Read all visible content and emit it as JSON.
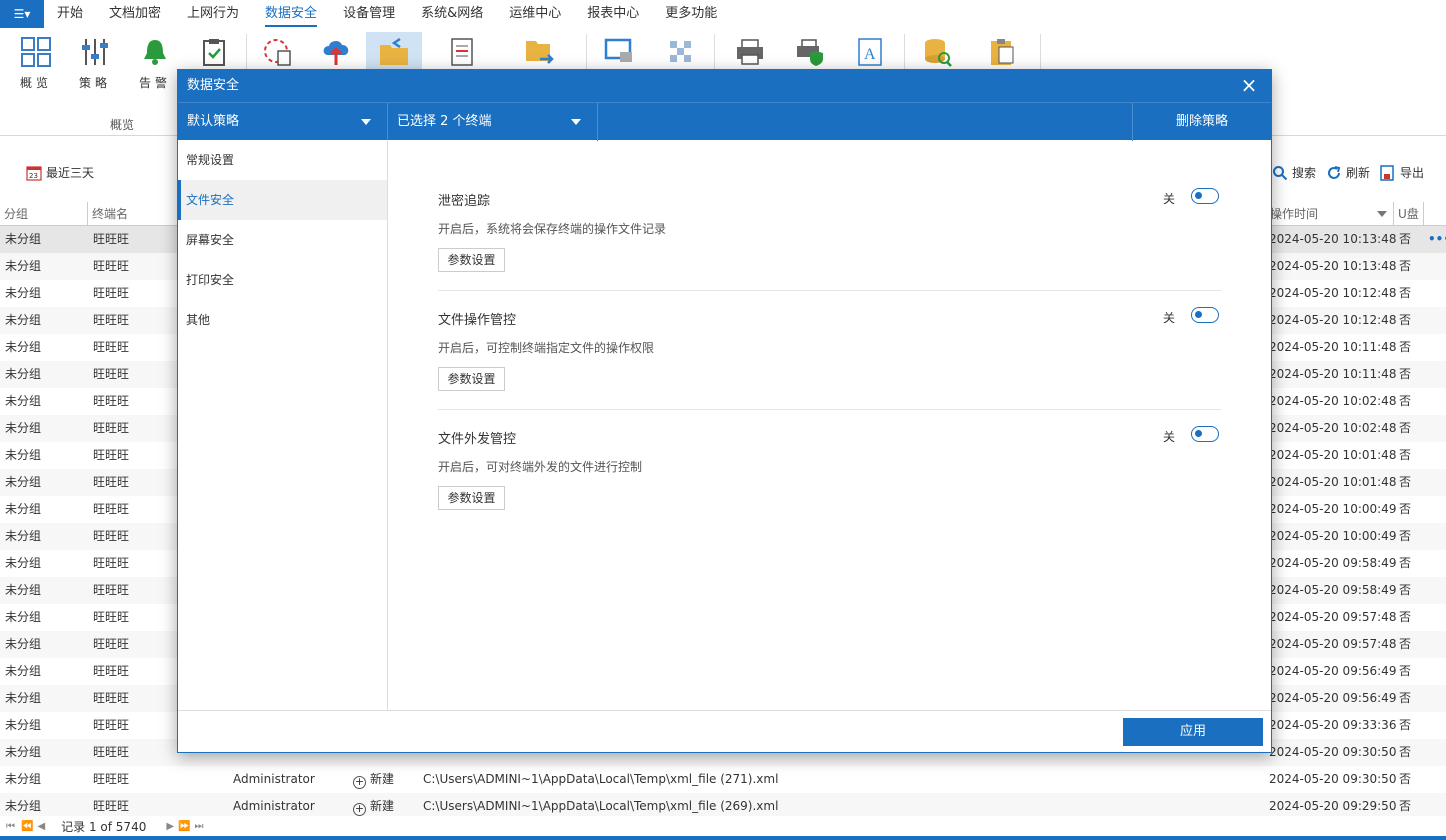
{
  "menubar": {
    "items": [
      "开始",
      "文档加密",
      "上网行为",
      "数据安全",
      "设备管理",
      "系统&网络",
      "运维中心",
      "报表中心",
      "更多功能"
    ],
    "active_index": 3
  },
  "ribbon": {
    "buttons": [
      {
        "label": "概览",
        "icon": "overview-grid-icon"
      },
      {
        "label": "策略",
        "icon": "policy-sliders-icon"
      },
      {
        "label": "告警",
        "icon": "alarm-bell-icon"
      }
    ],
    "group_label": "概览"
  },
  "toolbar": {
    "date_filter": "最近三天",
    "search": "搜索",
    "refresh": "刷新",
    "export": "导出"
  },
  "table": {
    "headers": {
      "group": "分组",
      "terminal": "终端名",
      "optime": "操作时间",
      "udisk": "U盘"
    },
    "rows": [
      {
        "group": "未分组",
        "terminal": "旺旺旺",
        "time": "2024-05-20 10:13:48",
        "udisk": "否"
      },
      {
        "group": "未分组",
        "terminal": "旺旺旺",
        "time": "2024-05-20 10:13:48",
        "udisk": "否"
      },
      {
        "group": "未分组",
        "terminal": "旺旺旺",
        "time": "2024-05-20 10:12:48",
        "udisk": "否"
      },
      {
        "group": "未分组",
        "terminal": "旺旺旺",
        "time": "2024-05-20 10:12:48",
        "udisk": "否"
      },
      {
        "group": "未分组",
        "terminal": "旺旺旺",
        "time": "2024-05-20 10:11:48",
        "udisk": "否"
      },
      {
        "group": "未分组",
        "terminal": "旺旺旺",
        "time": "2024-05-20 10:11:48",
        "udisk": "否"
      },
      {
        "group": "未分组",
        "terminal": "旺旺旺",
        "time": "2024-05-20 10:02:48",
        "udisk": "否"
      },
      {
        "group": "未分组",
        "terminal": "旺旺旺",
        "time": "2024-05-20 10:02:48",
        "udisk": "否"
      },
      {
        "group": "未分组",
        "terminal": "旺旺旺",
        "time": "2024-05-20 10:01:48",
        "udisk": "否"
      },
      {
        "group": "未分组",
        "terminal": "旺旺旺",
        "time": "2024-05-20 10:01:48",
        "udisk": "否"
      },
      {
        "group": "未分组",
        "terminal": "旺旺旺",
        "time": "2024-05-20 10:00:49",
        "udisk": "否"
      },
      {
        "group": "未分组",
        "terminal": "旺旺旺",
        "time": "2024-05-20 10:00:49",
        "udisk": "否"
      },
      {
        "group": "未分组",
        "terminal": "旺旺旺",
        "time": "2024-05-20 09:58:49",
        "udisk": "否"
      },
      {
        "group": "未分组",
        "terminal": "旺旺旺",
        "time": "2024-05-20 09:58:49",
        "udisk": "否"
      },
      {
        "group": "未分组",
        "terminal": "旺旺旺",
        "time": "2024-05-20 09:57:48",
        "udisk": "否"
      },
      {
        "group": "未分组",
        "terminal": "旺旺旺",
        "time": "2024-05-20 09:57:48",
        "udisk": "否"
      },
      {
        "group": "未分组",
        "terminal": "旺旺旺",
        "time": "2024-05-20 09:56:49",
        "udisk": "否"
      },
      {
        "group": "未分组",
        "terminal": "旺旺旺",
        "time": "2024-05-20 09:56:49",
        "udisk": "否"
      },
      {
        "group": "未分组",
        "terminal": "旺旺旺",
        "time": "2024-05-20 09:33:36",
        "udisk": "否"
      },
      {
        "group": "未分组",
        "terminal": "旺旺旺",
        "time": "2024-05-20 09:30:50",
        "udisk": "否"
      },
      {
        "group": "未分组",
        "terminal": "旺旺旺",
        "user": "Administrator",
        "action": "新建",
        "path": "C:\\Users\\ADMINI~1\\AppData\\Local\\Temp\\xml_file (271).xml",
        "time": "2024-05-20 09:30:50",
        "udisk": "否"
      },
      {
        "group": "未分组",
        "terminal": "旺旺旺",
        "user": "Administrator",
        "action": "新建",
        "path": "C:\\Users\\ADMINI~1\\AppData\\Local\\Temp\\xml_file (269).xml",
        "time": "2024-05-20 09:29:50",
        "udisk": "否"
      }
    ],
    "more_icon": "more-dots-icon"
  },
  "statusbar": {
    "record_text": "记录 1 of 5740"
  },
  "dialog": {
    "title": "数据安全",
    "policy_select": "默认策略",
    "terminal_select": "已选择 2 个终端",
    "delete_label": "删除策略",
    "nav": [
      "常规设置",
      "文件安全",
      "屏幕安全",
      "打印安全",
      "其他"
    ],
    "nav_active": 1,
    "sections": [
      {
        "title": "泄密追踪",
        "desc": "开启后，系统将会保存终端的操作文件记录",
        "toggle_label": "关",
        "button": "参数设置",
        "enabled": false
      },
      {
        "title": "文件操作管控",
        "desc": "开启后，可控制终端指定文件的操作权限",
        "toggle_label": "关",
        "button": "参数设置",
        "enabled": false
      },
      {
        "title": "文件外发管控",
        "desc": "开启后，可对终端外发的文件进行控制",
        "toggle_label": "关",
        "button": "参数设置",
        "enabled": false
      }
    ],
    "apply_label": "应用"
  },
  "colors": {
    "accent": "#1a6fc1"
  }
}
